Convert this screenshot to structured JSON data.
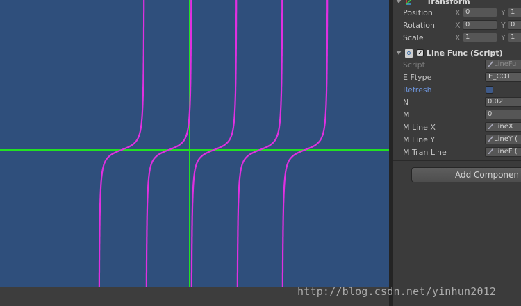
{
  "scene": {
    "background": "#2f4f7c",
    "axis_color": "#22e022",
    "curve_color": "#e030e0"
  },
  "inspector": {
    "transform": {
      "title": "Transform",
      "rows": [
        {
          "label": "Position",
          "x_axis": "X",
          "x": "0",
          "y_axis": "Y",
          "y": "1"
        },
        {
          "label": "Rotation",
          "x_axis": "X",
          "x": "0",
          "y_axis": "Y",
          "y": "0"
        },
        {
          "label": "Scale",
          "x_axis": "X",
          "x": "1",
          "y_axis": "Y",
          "y": "1"
        }
      ]
    },
    "line_func": {
      "title": "Line Func (Script)",
      "enabled": true,
      "script_label": "Script",
      "script_value": "LineFu",
      "ftype_label": "E Ftype",
      "ftype_value": "E_COT",
      "refresh_label": "Refresh",
      "n_label": "N",
      "n_value": "0.02",
      "m_label": "M",
      "m_value": "0",
      "mlinex_label": "M Line X",
      "mlinex_value": "LineX",
      "mliney_label": "M Line Y",
      "mliney_value": "LineY (",
      "mtranline_label": "M Tran Line",
      "mtranline_value": "LineF ("
    },
    "add_component": "Add Componen"
  },
  "watermark": "http://blog.csdn.net/yinhun2012"
}
